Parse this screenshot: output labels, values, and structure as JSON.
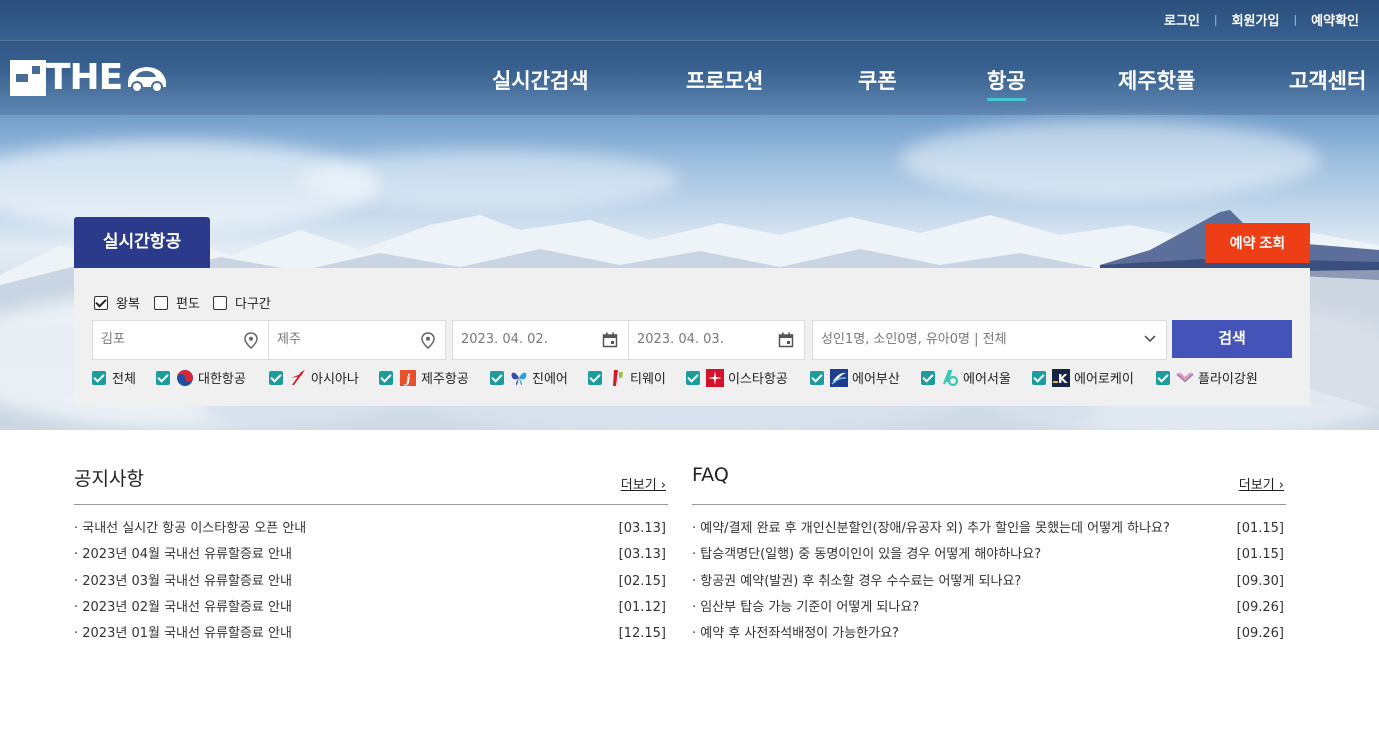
{
  "top_links": {
    "login": "로그인",
    "signup": "회원가입",
    "reservation_check": "예약확인"
  },
  "logo": {
    "text": "THE"
  },
  "nav": [
    "실시간검색",
    "프로모션",
    "쿠폰",
    "항공",
    "제주핫플",
    "고객센터"
  ],
  "search": {
    "tab_title": "실시간항공",
    "reservation_lookup_label": "예약 조회",
    "trip_types": [
      {
        "label": "왕복",
        "checked": true
      },
      {
        "label": "편도",
        "checked": false
      },
      {
        "label": "다구간",
        "checked": false
      }
    ],
    "from": "김포",
    "to": "제주",
    "depart_date": "2023. 04. 02.",
    "return_date": "2023. 04. 03.",
    "passengers": "성인1명, 소인0명, 유아0명 | 전체",
    "search_label": "검색",
    "airlines": [
      {
        "label": "전체",
        "checked": true
      },
      {
        "label": "대한항공",
        "checked": true
      },
      {
        "label": "아시아나",
        "checked": true
      },
      {
        "label": "제주항공",
        "checked": true
      },
      {
        "label": "진에어",
        "checked": true
      },
      {
        "label": "티웨이",
        "checked": true
      },
      {
        "label": "이스타항공",
        "checked": true
      },
      {
        "label": "에어부산",
        "checked": true
      },
      {
        "label": "에어서울",
        "checked": true
      },
      {
        "label": "에어로케이",
        "checked": true
      },
      {
        "label": "플라이강원",
        "checked": true
      }
    ]
  },
  "notice": {
    "title": "공지사항",
    "more": "더보기 ›",
    "items": [
      {
        "title": "· 국내선 실시간 항공 이스타항공 오픈 안내",
        "date": "[03.13]"
      },
      {
        "title": "· 2023년 04월 국내선 유류할증료 안내",
        "date": "[03.13]"
      },
      {
        "title": "· 2023년 03월 국내선 유류할증료 안내",
        "date": "[02.15]"
      },
      {
        "title": "· 2023년 02월 국내선 유류할증료 안내",
        "date": "[01.12]"
      },
      {
        "title": "· 2023년 01월 국내선 유류할증료 안내",
        "date": "[12.15]"
      }
    ]
  },
  "faq": {
    "title": "FAQ",
    "more": "더보기 ›",
    "items": [
      {
        "title": "· 예약/결제 완료 후 개인신분할인(장애/유공자 외) 추가 할인을 못했는데 어떻게 하나요?",
        "date": "[01.15]"
      },
      {
        "title": "· 탑승객명단(일행) 중 동명이인이 있을 경우 어떻게 해야하나요?",
        "date": "[01.15]"
      },
      {
        "title": "· 항공권 예약(발권) 후 취소할 경우 수수료는 어떻게 되나요?",
        "date": "[09.30]"
      },
      {
        "title": "· 임산부 탑승 가능 기준이 어떻게 되나요?",
        "date": "[09.26]"
      },
      {
        "title": "· 예약 후 사전좌석배정이 가능한가요?",
        "date": "[09.26]"
      }
    ]
  },
  "colors": {
    "tab_bg": "#2b3a8a",
    "reserve_btn": "#ee3e16",
    "search_btn": "#4353b7",
    "checkbox": "#1e9c9b",
    "nav_active_underline": "#41c8d3"
  }
}
